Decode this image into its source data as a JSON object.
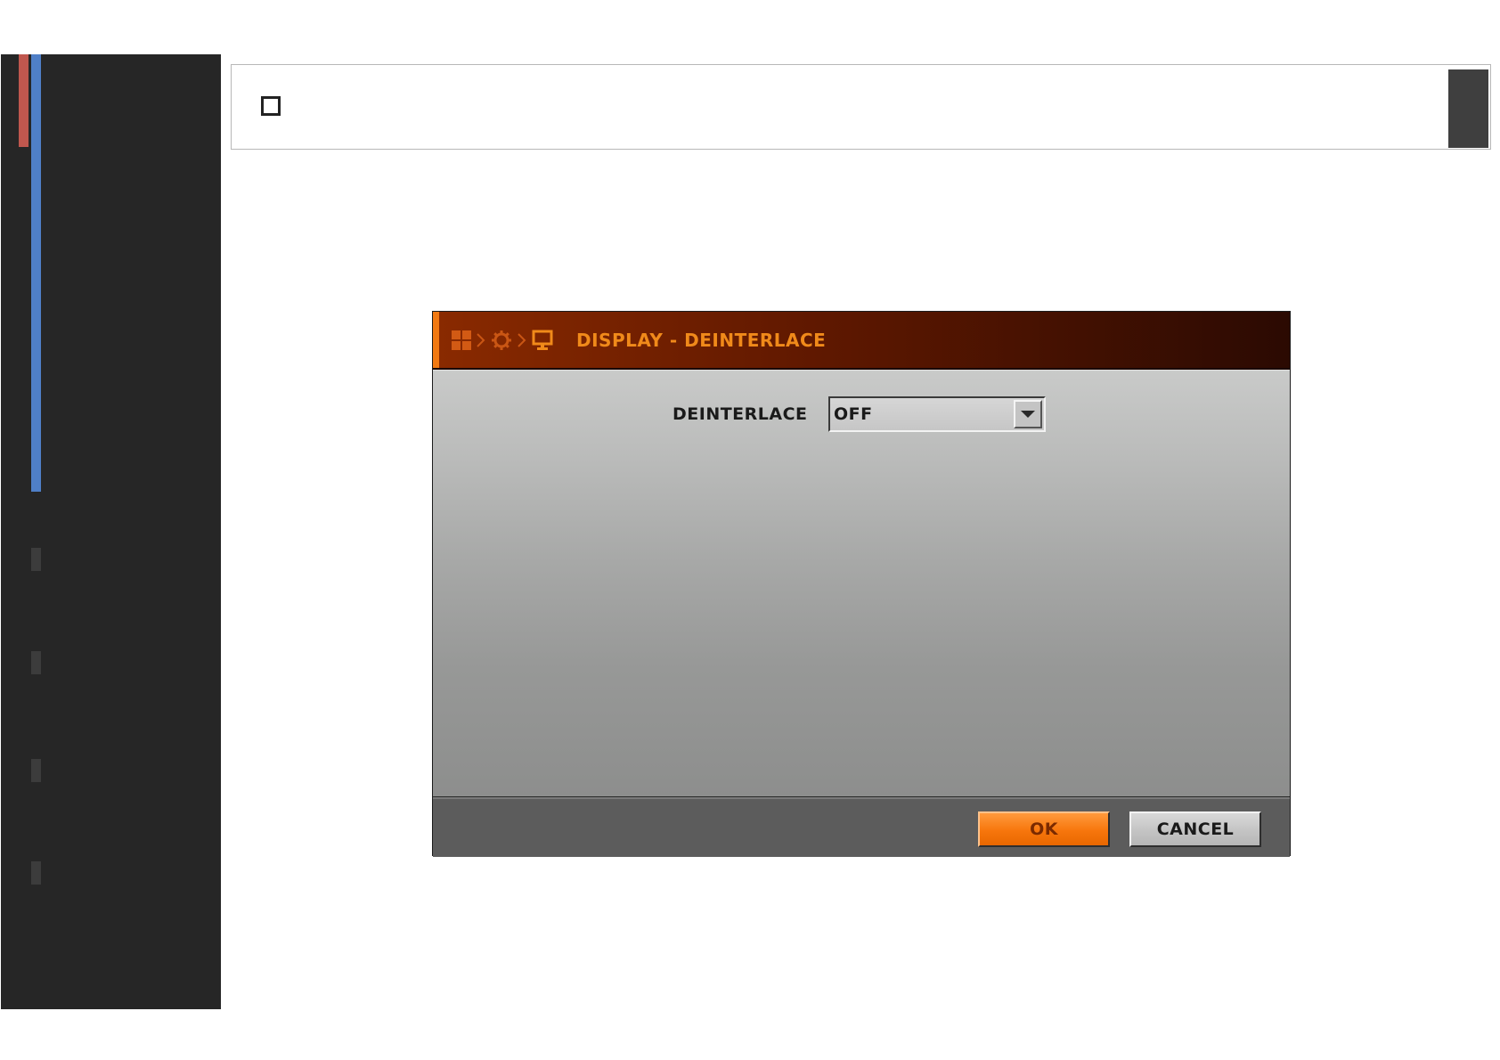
{
  "dialog": {
    "title": "DISPLAY - DEINTERLACE",
    "breadcrumb_icons": [
      "grid-icon",
      "gear-icon",
      "monitor-icon"
    ],
    "field": {
      "label": "DEINTERLACE",
      "value": "OFF"
    },
    "buttons": {
      "ok": "OK",
      "cancel": "CANCEL"
    }
  },
  "topbar": {
    "checkbox_checked": false
  },
  "colors": {
    "sidebar_bg": "#262626",
    "accent_red": "#c0574e",
    "accent_blue": "#4f7fc7",
    "title_orange": "#f08a1a",
    "ok_orange": "#f7760c"
  }
}
